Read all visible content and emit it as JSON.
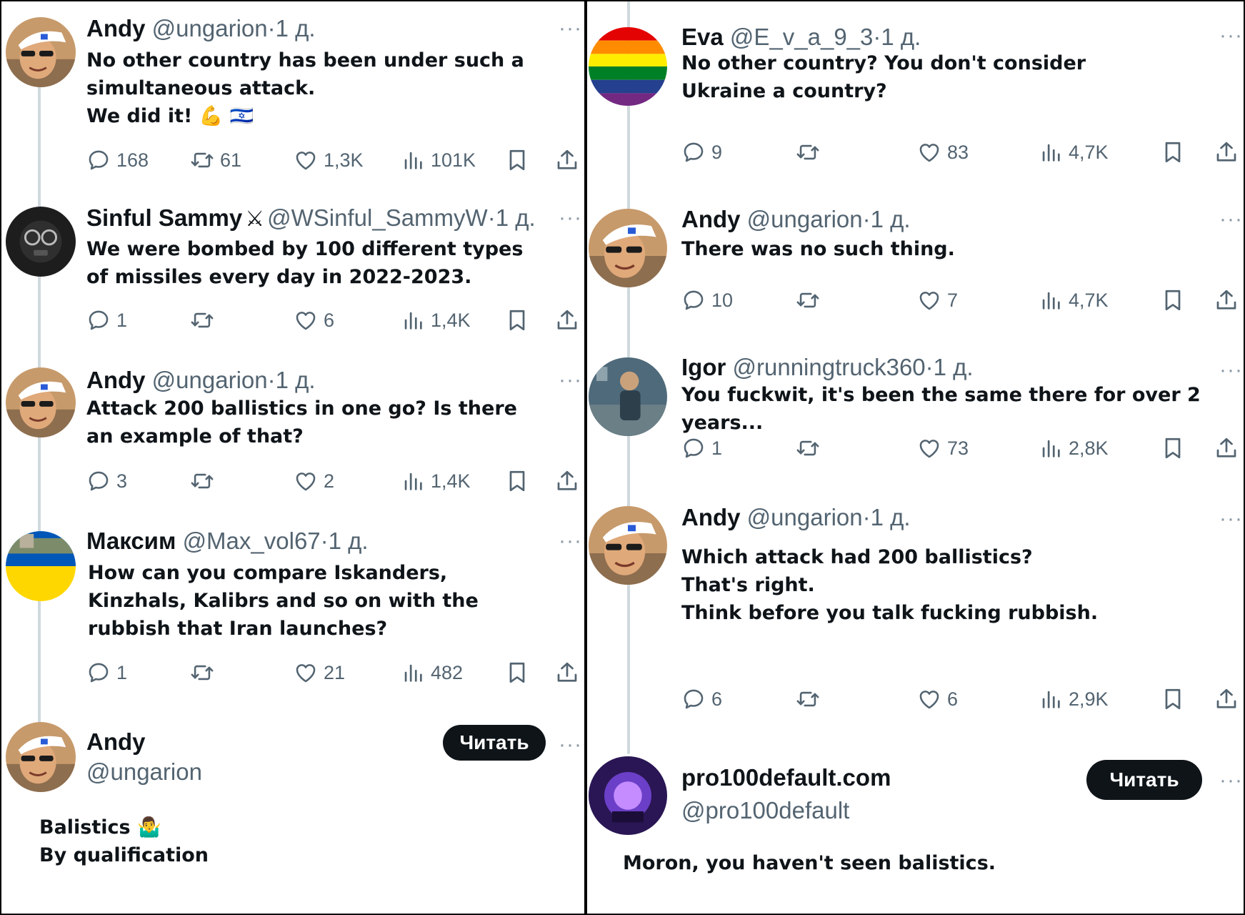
{
  "left": {
    "tweets": [
      {
        "name": "Andy",
        "handle": "@ungarion",
        "dot": "·",
        "time": "1 д.",
        "text": "No other country has been under such a\nsimultaneous attack.\nWe did it!",
        "emoji": "💪 🇮🇱",
        "reply": "168",
        "retweet": "61",
        "like": "1,3K",
        "views": "101K"
      },
      {
        "name": "Sinful Sammy",
        "name_emoji": "⚔",
        "handle": "@WSinful_SammyW",
        "dot": "·",
        "time": "1 д.",
        "text": "We were bombed by 100 different types\nof missiles every day in 2022-2023.",
        "reply": "1",
        "retweet": "",
        "like": "6",
        "views": "1,4K"
      },
      {
        "name": "Andy",
        "handle": "@ungarion",
        "dot": "·",
        "time": "1 д.",
        "text": "Attack 200 ballistics in one go? Is there\nan example of that?",
        "reply": "3",
        "retweet": "",
        "like": "2",
        "views": "1,4K"
      },
      {
        "name": "Максим",
        "handle": "@Max_vol67",
        "dot": "·",
        "time": "1 д.",
        "text": "How can you compare Iskanders,\nKinzhals, Kalibrs and so on with the\nrubbish that Iran launches?",
        "reply": "1",
        "retweet": "",
        "like": "21",
        "views": "482"
      }
    ],
    "profile": {
      "name": "Andy",
      "handle": "@ungarion",
      "follow_label": "Читать"
    },
    "caption": "Balistics 🤷‍♂️\nBy qualification"
  },
  "right": {
    "tweets": [
      {
        "name": "Eva",
        "handle": "@E_v_a_9_3",
        "dot": "·",
        "time": "1 д.",
        "text": "No other country? You don't consider\nUkraine a country?",
        "reply": "9",
        "retweet": "",
        "like": "83",
        "views": "4,7K"
      },
      {
        "name": "Andy",
        "handle": "@ungarion",
        "dot": "·",
        "time": "1 д.",
        "text": "There was no such thing.",
        "reply": "10",
        "retweet": "",
        "like": "7",
        "views": "4,7K"
      },
      {
        "name": "Igor",
        "handle": "@runningtruck360",
        "dot": "·",
        "time": "1 д.",
        "text": "You fuckwit, it's been the same there for over 2\nyears...",
        "reply": "1",
        "retweet": "",
        "like": "73",
        "views": "2,8K"
      },
      {
        "name": "Andy",
        "handle": "@ungarion",
        "dot": "·",
        "time": "1 д.",
        "text": "Which attack had 200 ballistics?\nThat's right.\nThink before you talk fucking rubbish.",
        "reply": "6",
        "retweet": "",
        "like": "6",
        "views": "2,9K"
      }
    ],
    "profile": {
      "name": "pro100default.com",
      "handle": "@pro100default",
      "follow_label": "Читать"
    },
    "caption": "Moron, you haven't seen balistics."
  },
  "more_label": "···",
  "colors": {
    "text": "#0f1419",
    "muted": "#536471",
    "thread_line": "#cfd9de",
    "button": "#0f1419"
  }
}
